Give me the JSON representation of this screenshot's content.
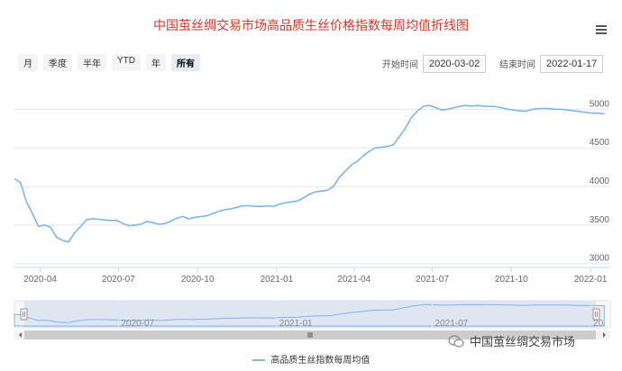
{
  "title": "中国茧丝绸交易市场高品质生丝价格指数每周均值折线图",
  "range_buttons": [
    "月",
    "季度",
    "半年",
    "YTD",
    "年",
    "所有"
  ],
  "active_range": "所有",
  "start_label": "开始时间",
  "start_value": "2020-03-02",
  "end_label": "结束时间",
  "end_value": "2022-01-17",
  "watermark": "中国茧丝绸交易市场",
  "colors": {
    "line": "#7cb5ec",
    "title": "#d9352a",
    "navigator": "#ccd6eb"
  },
  "chart_data": {
    "type": "line",
    "xlabel": "",
    "ylabel": "",
    "xlim": [
      "2020-03-02",
      "2022-01-24"
    ],
    "ylim": [
      2950,
      5250
    ],
    "x_ticks": [
      "2020-04",
      "2020-07",
      "2020-10",
      "2021-01",
      "2021-04",
      "2021-07",
      "2021-10",
      "2022-01"
    ],
    "y_ticks": [
      "3000",
      "3500",
      "4000",
      "4500",
      "5000"
    ],
    "navigator_ticks": [
      "2020-07",
      "2021-01",
      "2021-07",
      "20"
    ],
    "grid": true,
    "legend": "bottom",
    "series": [
      {
        "name": "高品质生丝指数每周均值",
        "points": [
          [
            "2020-03-02",
            4100
          ],
          [
            "2020-03-09",
            4050
          ],
          [
            "2020-03-16",
            3800
          ],
          [
            "2020-03-23",
            3650
          ],
          [
            "2020-03-30",
            3480
          ],
          [
            "2020-04-06",
            3500
          ],
          [
            "2020-04-13",
            3470
          ],
          [
            "2020-04-20",
            3340
          ],
          [
            "2020-04-27",
            3300
          ],
          [
            "2020-05-04",
            3280
          ],
          [
            "2020-05-11",
            3400
          ],
          [
            "2020-05-18",
            3480
          ],
          [
            "2020-05-25",
            3570
          ],
          [
            "2020-06-01",
            3580
          ],
          [
            "2020-06-08",
            3575
          ],
          [
            "2020-06-15",
            3565
          ],
          [
            "2020-06-22",
            3560
          ],
          [
            "2020-06-29",
            3560
          ],
          [
            "2020-07-06",
            3520
          ],
          [
            "2020-07-13",
            3490
          ],
          [
            "2020-07-20",
            3500
          ],
          [
            "2020-07-27",
            3510
          ],
          [
            "2020-08-03",
            3545
          ],
          [
            "2020-08-10",
            3530
          ],
          [
            "2020-08-17",
            3510
          ],
          [
            "2020-08-24",
            3520
          ],
          [
            "2020-08-31",
            3550
          ],
          [
            "2020-09-07",
            3590
          ],
          [
            "2020-09-14",
            3610
          ],
          [
            "2020-09-21",
            3580
          ],
          [
            "2020-09-28",
            3600
          ],
          [
            "2020-10-05",
            3610
          ],
          [
            "2020-10-12",
            3620
          ],
          [
            "2020-10-19",
            3650
          ],
          [
            "2020-10-26",
            3680
          ],
          [
            "2020-11-02",
            3700
          ],
          [
            "2020-11-09",
            3710
          ],
          [
            "2020-11-16",
            3730
          ],
          [
            "2020-11-23",
            3750
          ],
          [
            "2020-11-30",
            3750
          ],
          [
            "2020-12-07",
            3745
          ],
          [
            "2020-12-14",
            3740
          ],
          [
            "2020-12-21",
            3750
          ],
          [
            "2020-12-28",
            3740
          ],
          [
            "2021-01-04",
            3770
          ],
          [
            "2021-01-11",
            3790
          ],
          [
            "2021-01-18",
            3800
          ],
          [
            "2021-01-25",
            3810
          ],
          [
            "2021-02-01",
            3850
          ],
          [
            "2021-02-08",
            3900
          ],
          [
            "2021-02-15",
            3930
          ],
          [
            "2021-02-22",
            3940
          ],
          [
            "2021-03-01",
            3950
          ],
          [
            "2021-03-08",
            4000
          ],
          [
            "2021-03-15",
            4120
          ],
          [
            "2021-03-22",
            4200
          ],
          [
            "2021-03-29",
            4280
          ],
          [
            "2021-04-05",
            4330
          ],
          [
            "2021-04-12",
            4400
          ],
          [
            "2021-04-19",
            4460
          ],
          [
            "2021-04-26",
            4500
          ],
          [
            "2021-05-03",
            4510
          ],
          [
            "2021-05-10",
            4520
          ],
          [
            "2021-05-17",
            4540
          ],
          [
            "2021-05-24",
            4650
          ],
          [
            "2021-05-31",
            4760
          ],
          [
            "2021-06-07",
            4900
          ],
          [
            "2021-06-14",
            4980
          ],
          [
            "2021-06-21",
            5040
          ],
          [
            "2021-06-28",
            5050
          ],
          [
            "2021-07-05",
            5020
          ],
          [
            "2021-07-12",
            4990
          ],
          [
            "2021-07-19",
            5000
          ],
          [
            "2021-07-26",
            5020
          ],
          [
            "2021-08-02",
            5040
          ],
          [
            "2021-08-09",
            5050
          ],
          [
            "2021-08-16",
            5040
          ],
          [
            "2021-08-23",
            5050
          ],
          [
            "2021-08-30",
            5040
          ],
          [
            "2021-09-06",
            5040
          ],
          [
            "2021-09-13",
            5035
          ],
          [
            "2021-09-20",
            5020
          ],
          [
            "2021-09-27",
            5000
          ],
          [
            "2021-10-04",
            4990
          ],
          [
            "2021-10-11",
            4980
          ],
          [
            "2021-10-18",
            4975
          ],
          [
            "2021-10-25",
            5000
          ],
          [
            "2021-11-01",
            5010
          ],
          [
            "2021-11-08",
            5010
          ],
          [
            "2021-11-15",
            5010
          ],
          [
            "2021-11-22",
            5000
          ],
          [
            "2021-11-29",
            5000
          ],
          [
            "2021-12-06",
            4990
          ],
          [
            "2021-12-13",
            4980
          ],
          [
            "2021-12-20",
            4970
          ],
          [
            "2021-12-27",
            4960
          ],
          [
            "2022-01-03",
            4950
          ],
          [
            "2022-01-10",
            4950
          ],
          [
            "2022-01-17",
            4940
          ]
        ]
      }
    ]
  }
}
